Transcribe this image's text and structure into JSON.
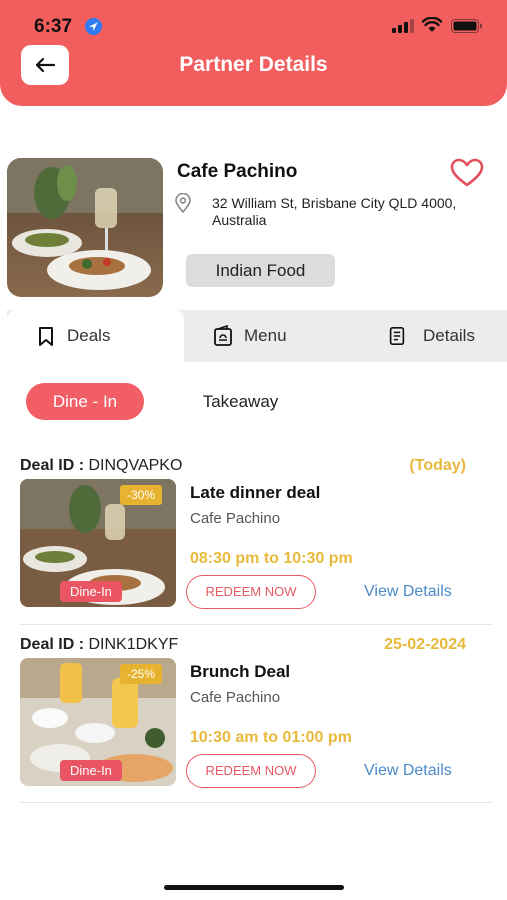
{
  "status": {
    "time": "6:37"
  },
  "header": {
    "title": "Partner Details"
  },
  "partner": {
    "name": "Cafe Pachino",
    "address": "32 William St, Brisbane City QLD 4000, Australia",
    "cuisine": "Indian Food"
  },
  "tabs": [
    {
      "label": "Deals"
    },
    {
      "label": "Menu"
    },
    {
      "label": "Details"
    }
  ],
  "filters": {
    "dine_in": "Dine - In",
    "takeaway": "Takeaway"
  },
  "deals": [
    {
      "id_label": "Deal ID :",
      "id": "DINQVAPKO",
      "date": "(Today)",
      "discount": "-30%",
      "tag": "Dine-In",
      "title": "Late dinner deal",
      "cafe": "Cafe Pachino",
      "time": "08:30 pm to 10:30 pm",
      "redeem": "REDEEM NOW",
      "view": "View Details"
    },
    {
      "id_label": "Deal ID :",
      "id": "DINK1DKYF",
      "date": "25-02-2024",
      "discount": "-25%",
      "tag": "Dine-In",
      "title": "Brunch Deal",
      "cafe": "Cafe Pachino",
      "time": "10:30 am to 01:00 pm",
      "redeem": "REDEEM NOW",
      "view": "View Details"
    }
  ],
  "colors": {
    "accent": "#f25e5e",
    "gold": "#e8b93c",
    "link": "#4a8bc8"
  }
}
